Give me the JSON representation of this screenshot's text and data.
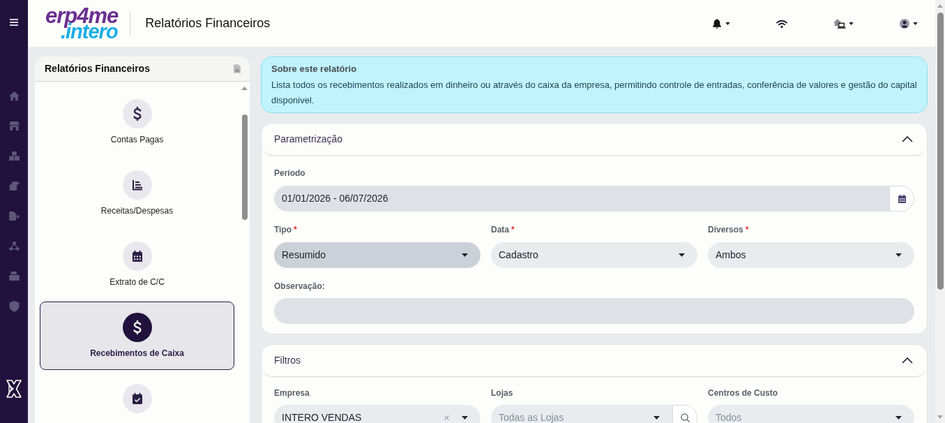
{
  "header": {
    "logo": {
      "line_1": "erp4me",
      "line_2": ".intero"
    },
    "title": "Relatórios Financeiros"
  },
  "sidebar": {
    "title": "Relatórios Financeiros",
    "items": [
      {
        "label": "Contas Pagas",
        "selected": false
      },
      {
        "label": "Receitas/Despesas",
        "selected": false
      },
      {
        "label": "Extrato de C/C",
        "selected": false
      },
      {
        "label": "Recebimentos de Caixa",
        "selected": true
      },
      {
        "selected": false
      }
    ]
  },
  "about": {
    "title": "Sobre este relatório",
    "text": "Lista todos os recebimentos realizados em dinheiro ou através do caixa da empresa, permitindo controle de entradas, conferência de valores e gestão do capital disponivel."
  },
  "parameters": {
    "title": "Parametrização",
    "expanded": true,
    "period": {
      "label": "Período",
      "value": "01/01/2026 - 06/07/2026"
    },
    "selects": [
      {
        "label": "Tipo",
        "required_mark": "*",
        "value": "Resumido",
        "focused": true
      },
      {
        "label": "Data",
        "required_mark": "*",
        "value": "Cadastro",
        "focused": false
      },
      {
        "label": "Diversos",
        "required_mark": "*",
        "value": "Ambos",
        "focused": false
      }
    ],
    "observation": {
      "label": "Observação:"
    }
  },
  "filters": {
    "title": "Filtros",
    "expanded": true,
    "fields": [
      {
        "kind": "clearable",
        "label": "Empresa",
        "value": "INTERO VENDAS"
      },
      {
        "kind": "search",
        "label": "Lojas",
        "placeholder": "Todas as Lojas"
      },
      {
        "kind": "plain",
        "label": "Centros de Custo",
        "placeholder": "Todos"
      }
    ]
  }
}
